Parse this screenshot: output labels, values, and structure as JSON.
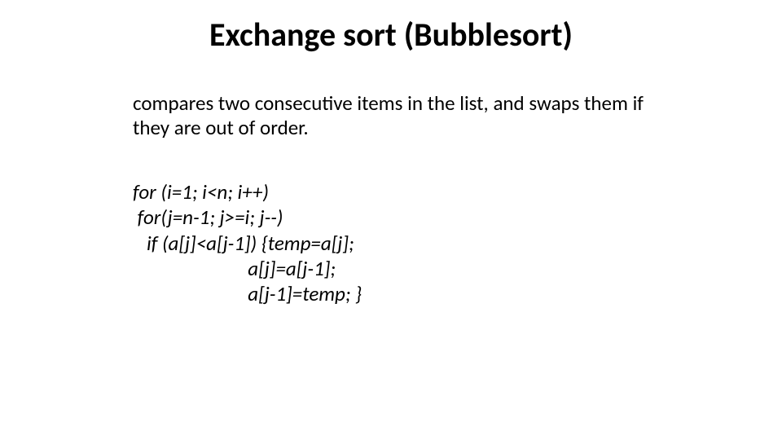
{
  "title": "Exchange sort (Bubblesort)",
  "description": "compares two consecutive items in the list, and swaps them if they are out of order.",
  "code": {
    "l1": "for (i=1; i<n; i++)",
    "l2": " for(j=n-1; j>=i; j--)",
    "l3": "   if (a[j]<a[j-1]) {temp=a[j];",
    "l4": "                         a[j]=a[j-1];",
    "l5": "                         a[j-1]=temp; }"
  }
}
